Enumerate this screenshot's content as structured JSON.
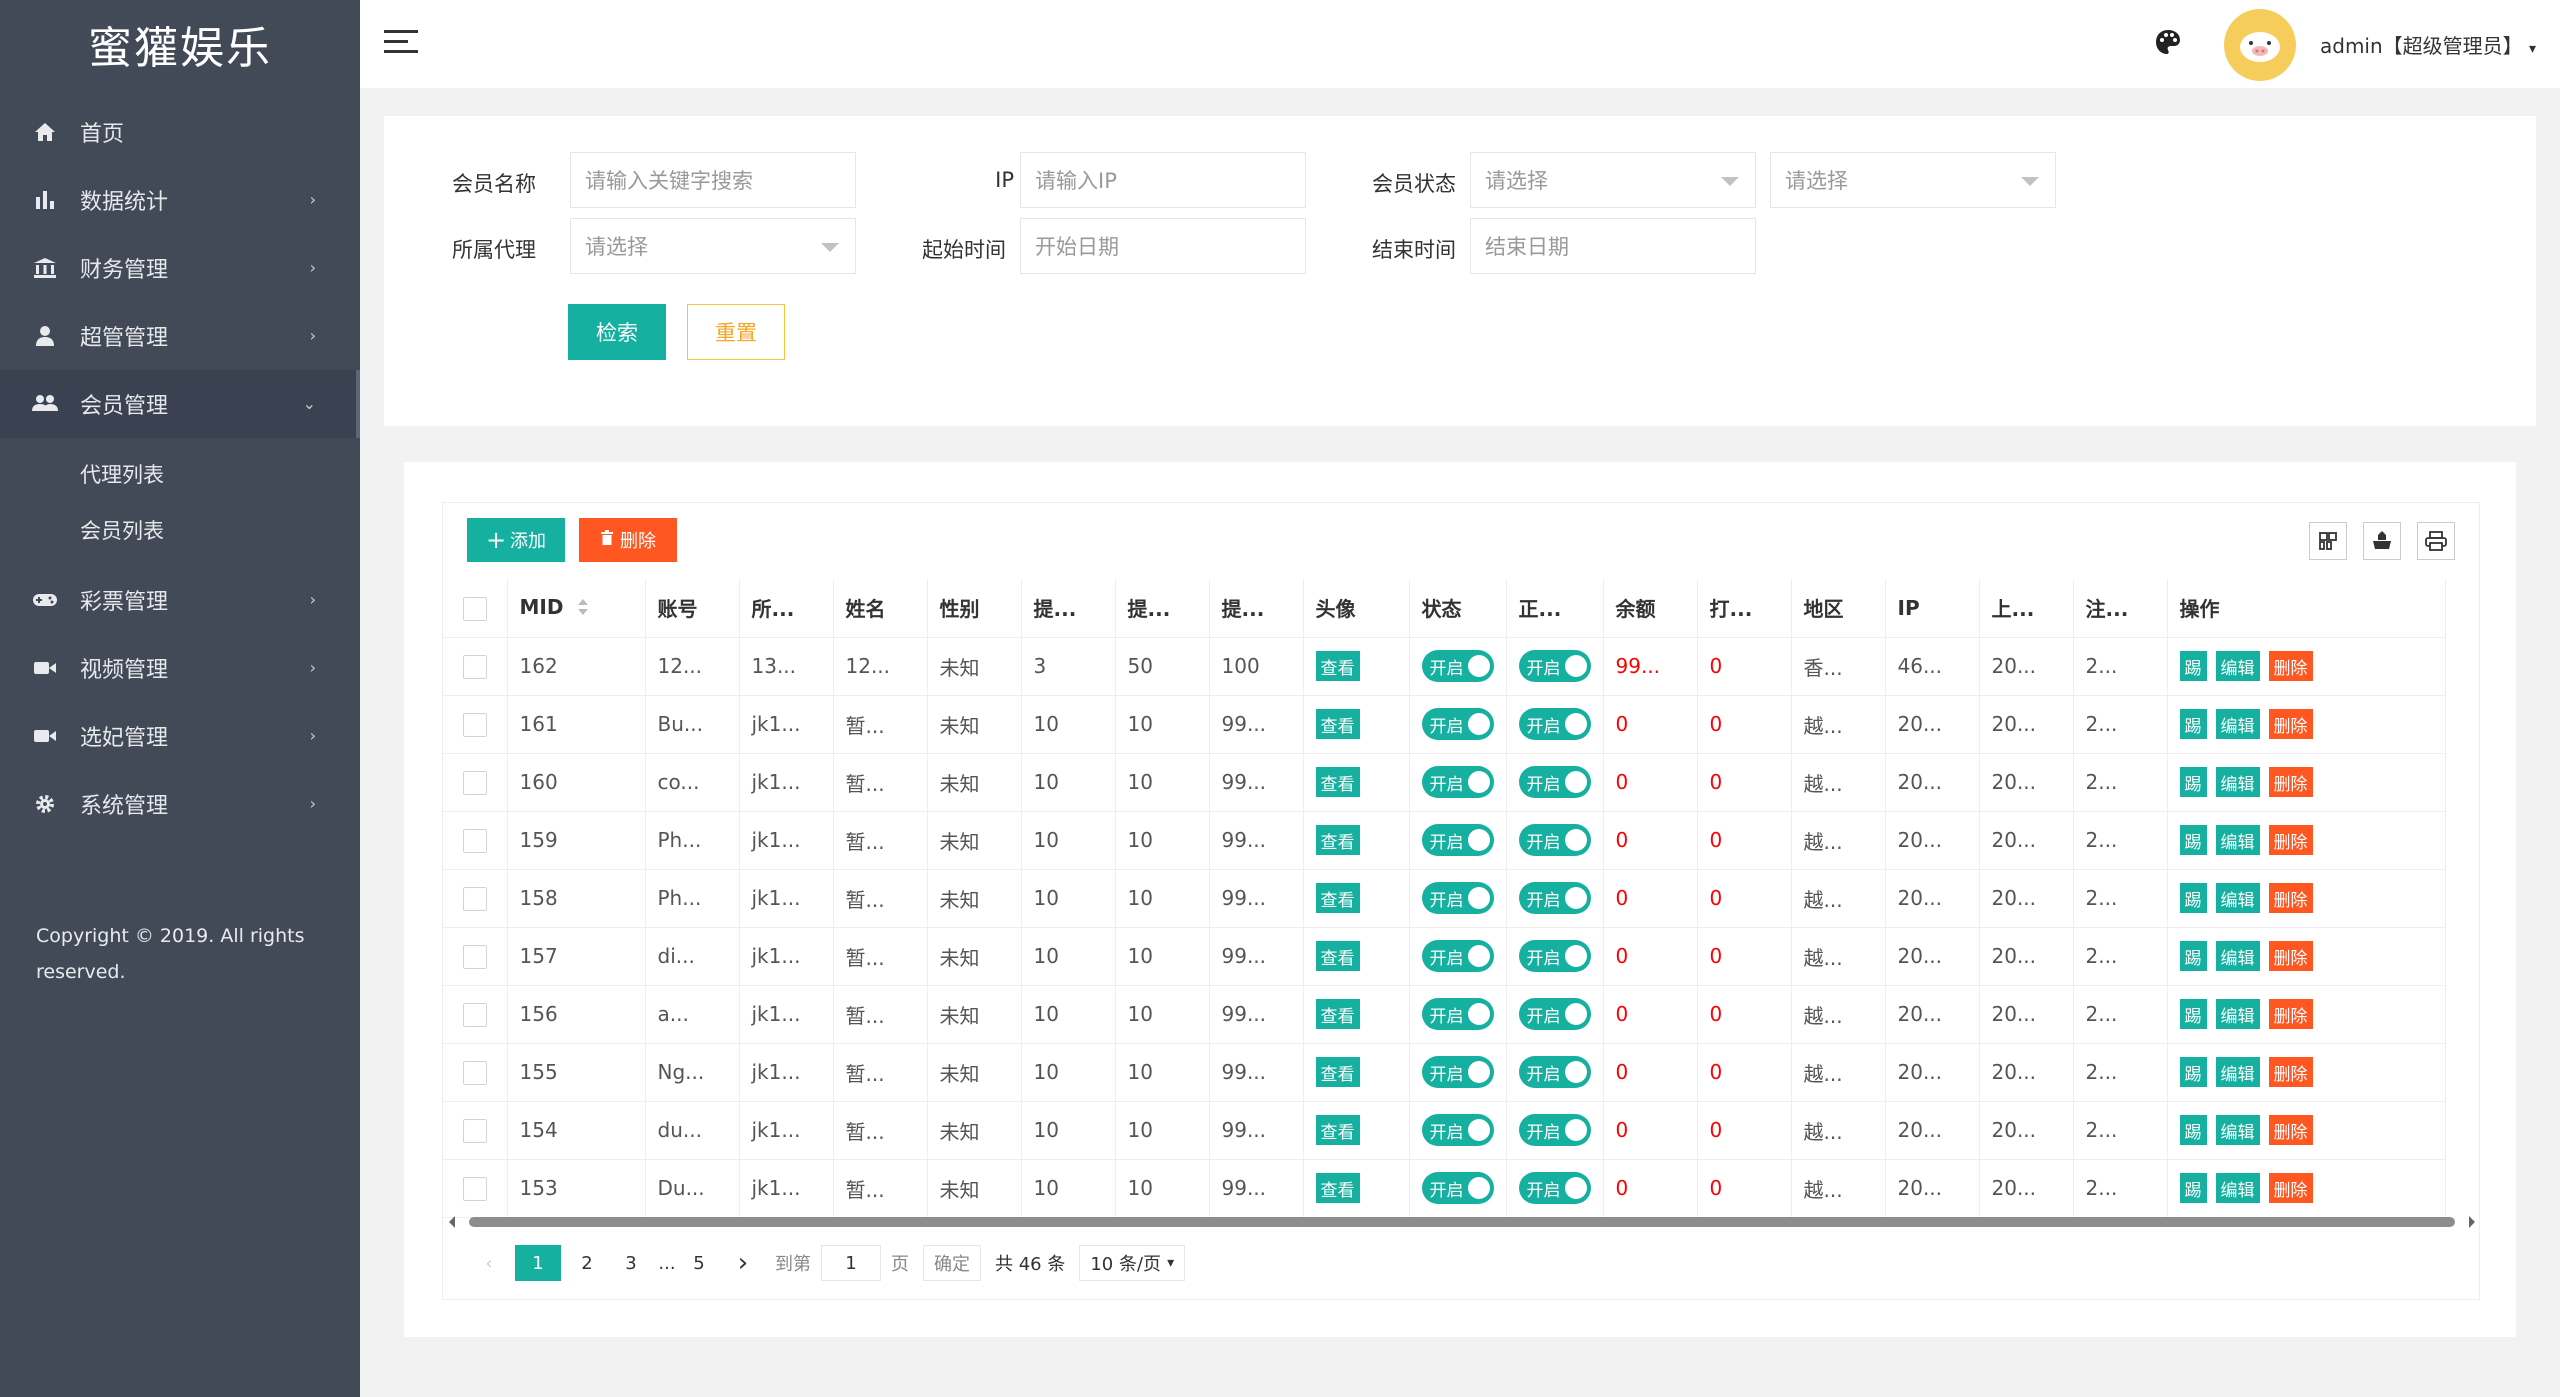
{
  "app": {
    "logo": "蜜獾娱乐"
  },
  "sidebar": {
    "items": [
      {
        "label": "首页",
        "icon": "home-icon"
      },
      {
        "label": "数据统计",
        "icon": "bar-chart-icon"
      },
      {
        "label": "财务管理",
        "icon": "bank-icon"
      },
      {
        "label": "超管管理",
        "icon": "user-icon"
      },
      {
        "label": "会员管理",
        "icon": "users-icon"
      },
      {
        "label": "彩票管理",
        "icon": "gamepad-icon"
      },
      {
        "label": "视频管理",
        "icon": "video-icon"
      },
      {
        "label": "选妃管理",
        "icon": "video-icon"
      },
      {
        "label": "系统管理",
        "icon": "gear-icon"
      }
    ],
    "subitems": [
      {
        "label": "代理列表"
      },
      {
        "label": "会员列表"
      }
    ],
    "copyright": "Copyright © 2019. All rights reserved."
  },
  "header": {
    "username": "admin【超级管理员】"
  },
  "search": {
    "member_name_label": "会员名称",
    "member_name_placeholder": "请输入关键字搜索",
    "ip_label": "IP",
    "ip_placeholder": "请输入IP",
    "status_label": "会员状态",
    "status_placeholder": "请选择",
    "status2_placeholder": "请选择",
    "agent_label": "所属代理",
    "agent_placeholder": "请选择",
    "start_label": "起始时间",
    "start_placeholder": "开始日期",
    "end_label": "结束时间",
    "end_placeholder": "结束日期",
    "search_button": "检索",
    "reset_button": "重置"
  },
  "toolbar": {
    "add_label": "添加",
    "delete_label": "删除"
  },
  "table": {
    "headers": [
      "MID",
      "账号",
      "所...",
      "姓名",
      "性别",
      "提...",
      "提...",
      "提...",
      "头像",
      "状态",
      "正...",
      "余额",
      "打...",
      "地区",
      "IP",
      "上...",
      "注...",
      "操作"
    ],
    "view_label": "查看",
    "switch_label": "开启",
    "action_kick": "踢",
    "action_edit": "编辑",
    "action_delete": "删除",
    "rows": [
      {
        "mid": "162",
        "account": "12...",
        "agent": "13...",
        "name": "12...",
        "gender": "未知",
        "w1": "3",
        "w2": "50",
        "w3": "100",
        "balance": "99...",
        "bet": "0",
        "region": "香...",
        "ip": "46...",
        "last": "20...",
        "reg": "2..."
      },
      {
        "mid": "161",
        "account": "Bu...",
        "agent": "jk1...",
        "name": "暂...",
        "gender": "未知",
        "w1": "10",
        "w2": "10",
        "w3": "99...",
        "balance": "0",
        "bet": "0",
        "region": "越...",
        "ip": "20...",
        "last": "20...",
        "reg": "2..."
      },
      {
        "mid": "160",
        "account": "co...",
        "agent": "jk1...",
        "name": "暂...",
        "gender": "未知",
        "w1": "10",
        "w2": "10",
        "w3": "99...",
        "balance": "0",
        "bet": "0",
        "region": "越...",
        "ip": "20...",
        "last": "20...",
        "reg": "2..."
      },
      {
        "mid": "159",
        "account": "Ph...",
        "agent": "jk1...",
        "name": "暂...",
        "gender": "未知",
        "w1": "10",
        "w2": "10",
        "w3": "99...",
        "balance": "0",
        "bet": "0",
        "region": "越...",
        "ip": "20...",
        "last": "20...",
        "reg": "2..."
      },
      {
        "mid": "158",
        "account": "Ph...",
        "agent": "jk1...",
        "name": "暂...",
        "gender": "未知",
        "w1": "10",
        "w2": "10",
        "w3": "99...",
        "balance": "0",
        "bet": "0",
        "region": "越...",
        "ip": "20...",
        "last": "20...",
        "reg": "2..."
      },
      {
        "mid": "157",
        "account": "di...",
        "agent": "jk1...",
        "name": "暂...",
        "gender": "未知",
        "w1": "10",
        "w2": "10",
        "w3": "99...",
        "balance": "0",
        "bet": "0",
        "region": "越...",
        "ip": "20...",
        "last": "20...",
        "reg": "2..."
      },
      {
        "mid": "156",
        "account": "a...",
        "agent": "jk1...",
        "name": "暂...",
        "gender": "未知",
        "w1": "10",
        "w2": "10",
        "w3": "99...",
        "balance": "0",
        "bet": "0",
        "region": "越...",
        "ip": "20...",
        "last": "20...",
        "reg": "2..."
      },
      {
        "mid": "155",
        "account": "Ng...",
        "agent": "jk1...",
        "name": "暂...",
        "gender": "未知",
        "w1": "10",
        "w2": "10",
        "w3": "99...",
        "balance": "0",
        "bet": "0",
        "region": "越...",
        "ip": "20...",
        "last": "20...",
        "reg": "2..."
      },
      {
        "mid": "154",
        "account": "du...",
        "agent": "jk1...",
        "name": "暂...",
        "gender": "未知",
        "w1": "10",
        "w2": "10",
        "w3": "99...",
        "balance": "0",
        "bet": "0",
        "region": "越...",
        "ip": "20...",
        "last": "20...",
        "reg": "2..."
      },
      {
        "mid": "153",
        "account": "Du...",
        "agent": "jk1...",
        "name": "暂...",
        "gender": "未知",
        "w1": "10",
        "w2": "10",
        "w3": "99...",
        "balance": "0",
        "bet": "0",
        "region": "越...",
        "ip": "20...",
        "last": "20...",
        "reg": "2..."
      }
    ]
  },
  "pagination": {
    "pages": [
      "1",
      "2",
      "3",
      "...",
      "5"
    ],
    "current": "1",
    "goto_label": "到第",
    "goto_value": "1",
    "page_unit": "页",
    "confirm_label": "确定",
    "total_label": "共 46 条",
    "page_size": "10 条/页"
  },
  "colors": {
    "accent": "#16b0a0",
    "danger": "#ff5722",
    "sidebar": "#424a58",
    "warning": "#f5a623"
  }
}
